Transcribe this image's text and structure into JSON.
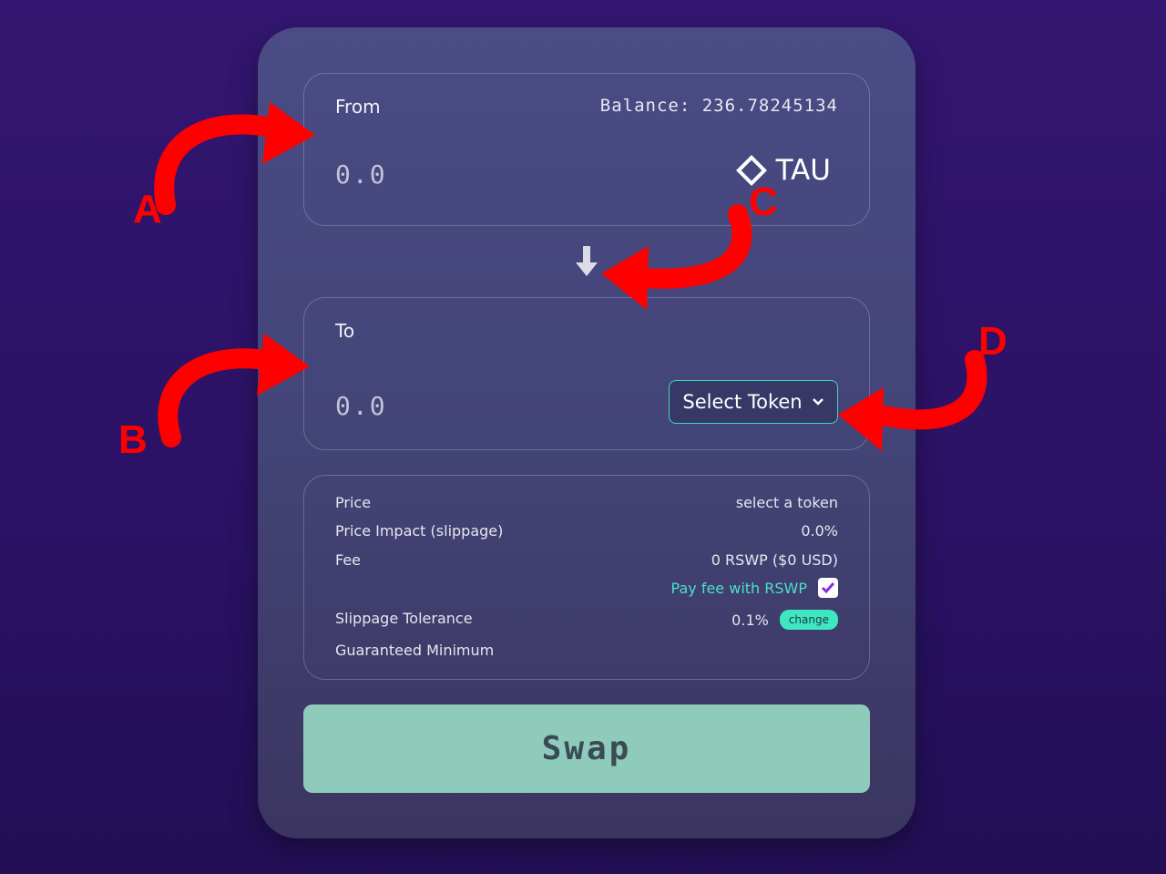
{
  "from": {
    "label": "From",
    "balance": "Balance: 236.78245134",
    "amount_placeholder": "0.0",
    "token": "TAU"
  },
  "to": {
    "label": "To",
    "amount_placeholder": "0.0",
    "select_token_label": "Select Token"
  },
  "info": {
    "price_label": "Price",
    "price_value": "select a token",
    "impact_label": "Price Impact (slippage)",
    "impact_value": "0.0%",
    "fee_label": "Fee",
    "fee_value": "0 RSWP ($0 USD)",
    "pay_fee_label": "Pay fee with RSWP",
    "pay_fee_checked": true,
    "slippage_label": "Slippage Tolerance",
    "slippage_value": "0.1%",
    "change_label": "change",
    "guaranteed_label": "Guaranteed Minimum"
  },
  "swap_label": "Swap",
  "annotations": {
    "a": "A",
    "b": "B",
    "c": "C",
    "d": "D"
  },
  "colors": {
    "accent": "#3fd6c4",
    "swap_button": "#8ecbbb",
    "annotation": "#ff0000"
  }
}
